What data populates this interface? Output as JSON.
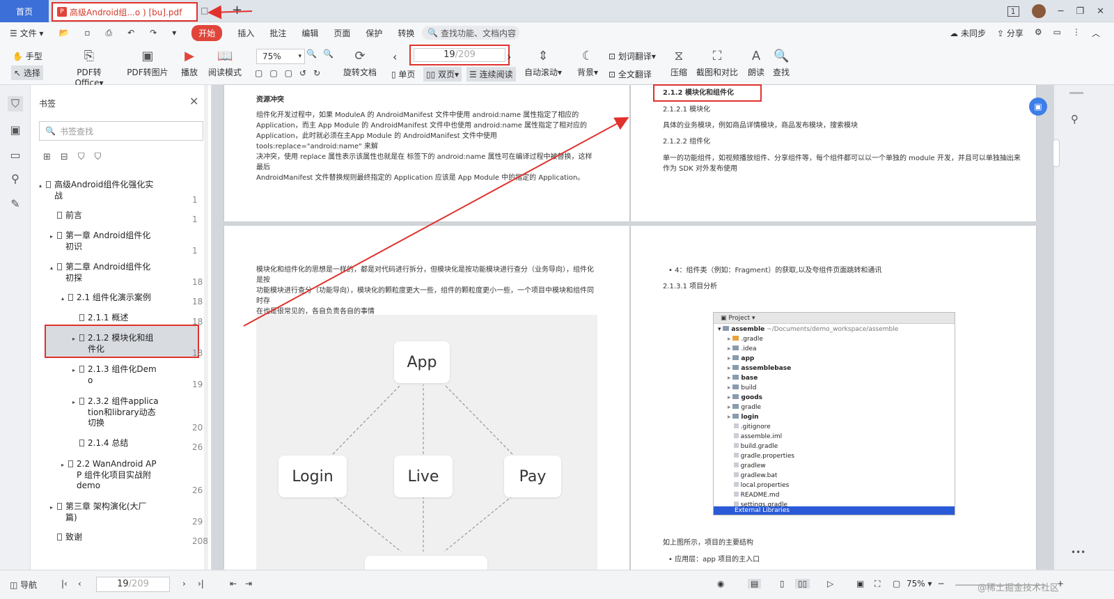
{
  "titlebar": {
    "home_tab": "首页",
    "doc_tab": "高级Android组...o ) [bu].pdf",
    "page_counter_top": "1"
  },
  "menu": {
    "file": "文件",
    "start": "开始",
    "insert": "插入",
    "annotate": "批注",
    "edit": "编辑",
    "page": "页面",
    "protect": "保护",
    "convert": "转换",
    "search_placeholder": "查找功能、文档内容",
    "unsynced": "未同步",
    "share": "分享"
  },
  "toolbar": {
    "hand": "手型",
    "select": "选择",
    "pdf_to_office": "PDF转Office",
    "pdf_to_image": "PDF转图片",
    "play": "播放",
    "read_mode": "阅读模式",
    "zoom": "75%",
    "page_current": "19",
    "page_total": "/209",
    "rotate": "旋转文档",
    "single": "单页",
    "double": "双页",
    "continuous": "连续阅读",
    "auto_scroll": "自动滚动",
    "background": "背景",
    "word_translate": "划词翻译",
    "full_translate": "全文翻译",
    "compress": "压缩",
    "screenshot_compare": "截图和对比",
    "read_aloud": "朗读",
    "find": "查找"
  },
  "bookmarks": {
    "title": "书签",
    "search_placeholder": "书签查找",
    "items": [
      {
        "label": "高级Android组件化强化实",
        "label2": "战",
        "page": "1"
      },
      {
        "label": "前言",
        "page": "1"
      },
      {
        "label": "第一章 Android组件化",
        "label2": "初识",
        "page": "1"
      },
      {
        "label": "第二章 Android组件化",
        "label2": "初探",
        "page": "18"
      },
      {
        "label": "2.1 组件化演示案例",
        "page": "18"
      },
      {
        "label": "2.1.1 概述",
        "page": "18"
      },
      {
        "label": "2.1.2 模块化和组",
        "label2": "件化",
        "page": "18"
      },
      {
        "label": "2.1.3 组件化Dem",
        "label2": "o",
        "page": "19"
      },
      {
        "label": "2.3.2 组件applica",
        "label2": "tion和library动态",
        "label3": "切换",
        "page": "20"
      },
      {
        "label": "2.1.4 总结",
        "page": "26"
      },
      {
        "label": "2.2 WanAndroid AP",
        "label2": "P 组件化项目实战附",
        "label3": "demo",
        "page": "26"
      },
      {
        "label": "第三章 架构演化(大厂",
        "label2": "篇)",
        "page": "29"
      },
      {
        "label": "致谢",
        "page": "208"
      }
    ]
  },
  "doc": {
    "p1_heading": "资源冲突",
    "p1_lines": [
      "组件化开发过程中，如果 ModuleA 的 AndroidManifest 文件中使用 android:name 属性指定了相应的",
      "Application，而主 App Module 的 AndroidManifest 文件中也使用 android:name 属性指定了相对应的",
      "Application，此时就必须在主App Module 的 AndroidManifest 文件中使用 tools:replace=\"android:name\" 来解",
      "决冲突，使用 replace 属性表示该属性也就是在 标签下的 android:name 属性可在编译过程中被替换，这样最后",
      "AndroidManifest 文件替换规则最终指定的 Application 应该是 App Module 中的指定的 Application。"
    ],
    "p2_heading": "2.1.2 模块化和组件化",
    "p2_sub1": "2.1.2.1 模块化",
    "p2_text1": "具体的业务模块，例如商品详情模块，商品发布模块，搜索模块",
    "p2_sub2": "2.1.2.2 组件化",
    "p2_text2a": "单一的功能组件，如视频播放组件、分享组件等，每个组件都可以以一个单独的 module 开发，并且可以单独抽出来",
    "p2_text2b": "作为 SDK 对外发布使用",
    "p3_lines": [
      "模块化和组件化的思想是一样的，都是对代码进行拆分，但模块化是按功能模块进行查分（业务导向），组件化是按",
      "功能模块进行查分（功能导向），模块化的颗粒度更大一些，组件的颗粒度更小一些，一个项目中模块和组件同时存",
      "在也是很常见的，各自负责各自的事情"
    ],
    "diagram": {
      "app": "App",
      "login": "Login",
      "live": "Live",
      "pay": "Pay"
    },
    "p4_bullet": "4：组件类（例如：Fragment）的获取,以及夸组件页面跳转和通讯",
    "p4_sub": "2.1.3.1 项目分析",
    "p4_caption": "如上图所示，项目的主要结构",
    "p4_bullet2": "应用层：app 项目的主入口",
    "ide": {
      "header": "Project",
      "root": "assemble",
      "root_path": "~/Documents/demo_workspace/assemble",
      "rows": [
        ".gradle",
        ".idea",
        "app",
        "assemblebase",
        "base",
        "build",
        "goods",
        "gradle",
        "login",
        ".gitignore",
        "assemble.iml",
        "build.gradle",
        "gradle.properties",
        "gradlew",
        "gradlew.bat",
        "local.properties",
        "README.md",
        "settings.gradle"
      ],
      "ext": "External Libraries"
    }
  },
  "status": {
    "nav": "导航",
    "page_current": "19",
    "page_total": "/209",
    "zoom": "75%",
    "watermark": "@稀土掘金技术社区"
  },
  "colors": {
    "accent_red": "#e0312c",
    "brand_blue": "#3d6fd8"
  }
}
